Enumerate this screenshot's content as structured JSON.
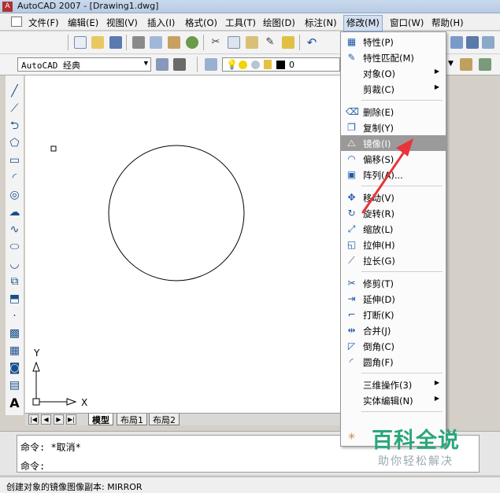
{
  "window": {
    "title": "AutoCAD 2007 - [Drawing1.dwg]"
  },
  "menubar": {
    "items": [
      "文件(F)",
      "编辑(E)",
      "视图(V)",
      "插入(I)",
      "格式(O)",
      "工具(T)",
      "绘图(D)",
      "标注(N)",
      "修改(M)",
      "窗口(W)",
      "帮助(H)"
    ],
    "active": "修改(M)"
  },
  "toolbar": {
    "workspace": "AutoCAD 经典",
    "layer_value": "0"
  },
  "modify_menu": {
    "items": [
      {
        "label": "特性(P)",
        "icon": "properties-icon",
        "glyph": "▦"
      },
      {
        "label": "特性匹配(M)",
        "icon": "match-properties-icon",
        "glyph": "✎"
      },
      {
        "label": "对象(O)",
        "submenu": true
      },
      {
        "label": "剪裁(C)",
        "submenu": true
      },
      {
        "label": "删除(E)",
        "icon": "erase-icon",
        "glyph": "⌫"
      },
      {
        "label": "复制(Y)",
        "icon": "copy-icon",
        "glyph": "❐"
      },
      {
        "label": "镜像(I)",
        "icon": "mirror-icon",
        "glyph": "⧍",
        "highlighted": true
      },
      {
        "label": "偏移(S)",
        "icon": "offset-icon",
        "glyph": "◠"
      },
      {
        "label": "阵列(A)...",
        "icon": "array-icon",
        "glyph": "▣"
      },
      {
        "label": "移动(V)",
        "icon": "move-icon",
        "glyph": "✥"
      },
      {
        "label": "旋转(R)",
        "icon": "rotate-icon",
        "glyph": "↻"
      },
      {
        "label": "缩放(L)",
        "icon": "scale-icon",
        "glyph": "⤢"
      },
      {
        "label": "拉伸(H)",
        "icon": "stretch-icon",
        "glyph": "◱"
      },
      {
        "label": "拉长(G)",
        "icon": "lengthen-icon",
        "glyph": "⟋"
      },
      {
        "label": "修剪(T)",
        "icon": "trim-icon",
        "glyph": "✂"
      },
      {
        "label": "延伸(D)",
        "icon": "extend-icon",
        "glyph": "⇥"
      },
      {
        "label": "打断(K)",
        "icon": "break-icon",
        "glyph": "⌐"
      },
      {
        "label": "合并(J)",
        "icon": "join-icon",
        "glyph": "⇹"
      },
      {
        "label": "倒角(C)",
        "icon": "chamfer-icon",
        "glyph": "◸"
      },
      {
        "label": "圆角(F)",
        "icon": "fillet-icon",
        "glyph": "◜"
      },
      {
        "label": "三维操作(3)",
        "submenu": true
      },
      {
        "label": "实体编辑(N)",
        "submenu": true
      }
    ]
  },
  "layout_tabs": [
    "模型",
    "布局1",
    "布局2"
  ],
  "axes": {
    "y": "Y",
    "x": "X"
  },
  "command": {
    "line1": "命令:  *取消*",
    "line2": "命令:"
  },
  "status": {
    "text": "创建对象的镜像图像副本:  MIRROR"
  },
  "watermark": {
    "title": "百科全说",
    "subtitle": "助你轻松解决"
  }
}
